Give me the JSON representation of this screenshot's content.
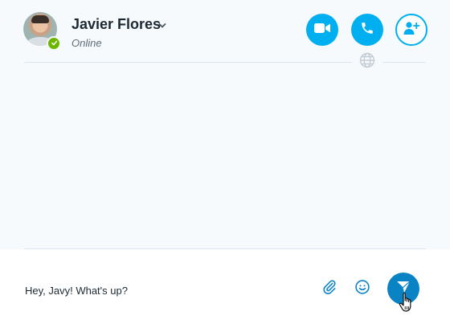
{
  "contact": {
    "name": "Javier Flores",
    "status": "Online",
    "status_color": "#6bb700"
  },
  "header": {
    "actions": [
      {
        "name": "video-call-button",
        "icon": "video-camera-icon"
      },
      {
        "name": "audio-call-button",
        "icon": "phone-icon"
      },
      {
        "name": "add-people-button",
        "icon": "add-person-icon"
      }
    ]
  },
  "compose": {
    "message_value": "Hey, Javy! What's up?",
    "attach_icon": "paperclip-icon",
    "emoji_icon": "smiley-icon",
    "send_icon": "send-icon"
  },
  "colors": {
    "accent": "#00aff0",
    "send": "#0a83c5",
    "chat_background": "#f6fafd"
  }
}
